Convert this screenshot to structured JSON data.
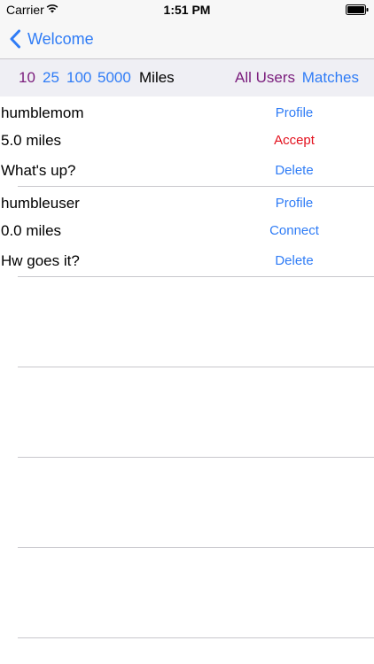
{
  "status_bar": {
    "carrier": "Carrier",
    "time": "1:51 PM"
  },
  "nav": {
    "back_label": "Welcome"
  },
  "filters": {
    "distances": [
      "10",
      "25",
      "100",
      "5000"
    ],
    "unit_label": "Miles",
    "all_users_label": "All Users",
    "matches_label": "Matches"
  },
  "rows": [
    {
      "username": "humblemom",
      "distance": "5.0 miles",
      "message": "What's up?",
      "profile_label": "Profile",
      "action_label": "Accept",
      "delete_label": "Delete"
    },
    {
      "username": "humbleuser",
      "distance": "0.0 miles",
      "message": "Hw goes it?",
      "profile_label": "Profile",
      "action_label": "Connect",
      "delete_label": "Delete"
    }
  ],
  "colors": {
    "tint": "#2f7cf6",
    "selected": "#7a1c7c",
    "accept": "#e3101d",
    "separator": "#c8c7cc",
    "bar_background": "#f7f7f7",
    "filter_background": "#efeff4"
  }
}
